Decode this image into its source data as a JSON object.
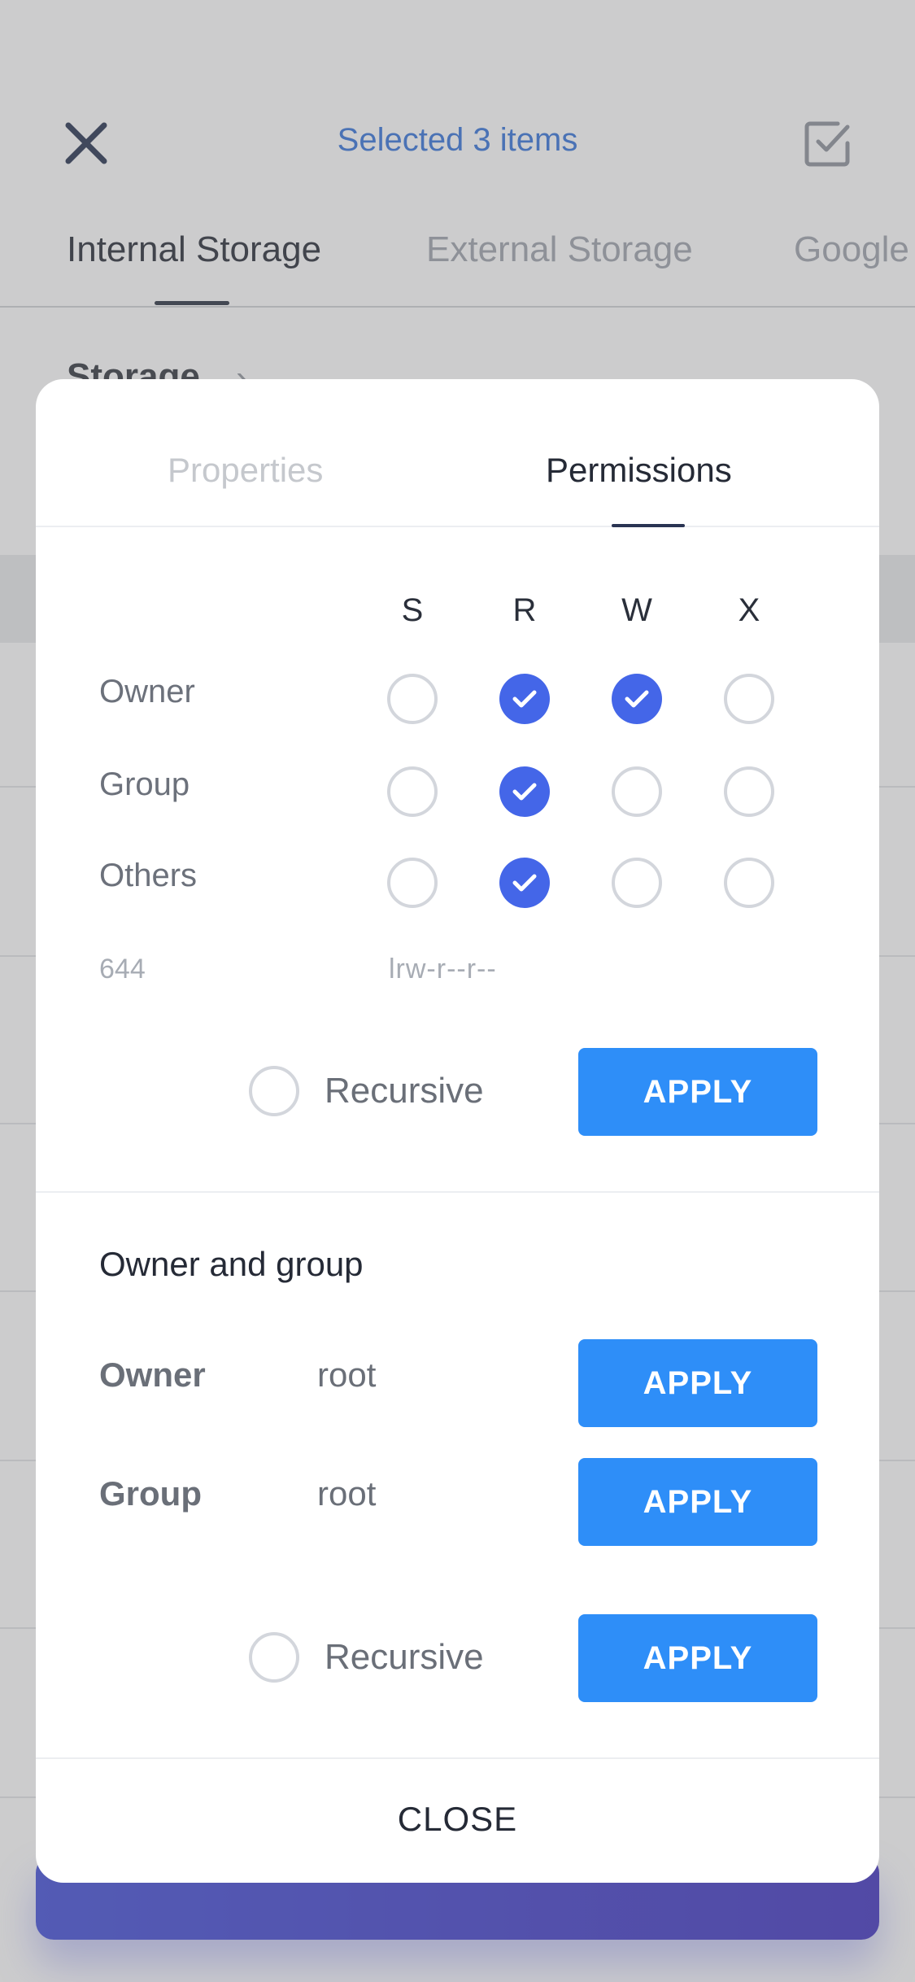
{
  "header": {
    "title": "Selected 3 items"
  },
  "tabs": [
    {
      "label": "Internal Storage",
      "active": true
    },
    {
      "label": "External Storage",
      "active": false
    },
    {
      "label": "Google",
      "active": false
    }
  ],
  "breadcrumb": {
    "label": "Storage"
  },
  "dialog": {
    "tabs": {
      "properties": "Properties",
      "permissions": "Permissions"
    },
    "columns": [
      "S",
      "R",
      "W",
      "X"
    ],
    "rows": [
      {
        "label": "Owner",
        "values": [
          false,
          true,
          true,
          false
        ]
      },
      {
        "label": "Group",
        "values": [
          false,
          true,
          false,
          false
        ]
      },
      {
        "label": "Others",
        "values": [
          false,
          true,
          false,
          false
        ]
      }
    ],
    "octal": "644",
    "symbolic": "lrw-r--r--",
    "recursive_label": "Recursive",
    "apply_label": "APPLY",
    "owner_group": {
      "title": "Owner and group",
      "owner_label": "Owner",
      "owner_value": "root",
      "group_label": "Group",
      "group_value": "root",
      "recursive_label": "Recursive",
      "apply_label": "APPLY"
    },
    "close_label": "CLOSE"
  },
  "colors": {
    "accent": "#2e8ef8",
    "checked": "#4466e8",
    "title_blue": "#2e6fd8"
  }
}
